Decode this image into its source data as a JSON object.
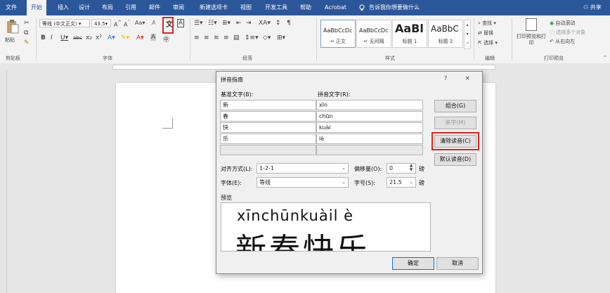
{
  "tabs": [
    "文件",
    "开始",
    "插入",
    "设计",
    "布局",
    "引用",
    "邮件",
    "审阅",
    "新建选项卡",
    "视图",
    "开发工具",
    "帮助",
    "Acrobat"
  ],
  "active_tab": "开始",
  "tell_me": "告诉我你想要做什么",
  "share": "共享",
  "ribbon": {
    "paste": "粘贴",
    "font_name": "等线 (中文正文)",
    "font_size": "43.5",
    "styles": [
      {
        "sample": "AaBbCcDc",
        "name": "正文"
      },
      {
        "sample": "AaBbCcDc",
        "name": "无间隔"
      },
      {
        "sample": "AaBl",
        "name": "标题 1"
      },
      {
        "sample": "AaBbC",
        "name": "标题 2"
      }
    ],
    "find": "查找",
    "replace": "替换",
    "select": "选择",
    "print_preview": "打印预览和打印",
    "auto_scroll": "自动滚动",
    "select_multi": "选择多个对象",
    "rtl": "从右向左",
    "groups": [
      "剪贴板",
      "字体",
      "段落",
      "样式",
      "编辑",
      "打印预览"
    ]
  },
  "dialog": {
    "title": "拼音指南",
    "help": "?",
    "close": "✕",
    "base_label": "基准文字(B):",
    "ruby_label": "拼音文字(R):",
    "rows": [
      {
        "base": "新",
        "ruby": "xīn"
      },
      {
        "base": "春",
        "ruby": "chūn"
      },
      {
        "base": "快",
        "ruby": "kuài"
      },
      {
        "base": "乐",
        "ruby": "lè"
      },
      {
        "base": "",
        "ruby": ""
      }
    ],
    "btn_group": "组合(G)",
    "btn_mono": "单字(M)",
    "btn_clear": "清除读音(C)",
    "btn_default": "默认读音(D)",
    "align_label": "对齐方式(L):",
    "align_value": "1-2-1",
    "offset_label": "偏移量(O):",
    "offset_value": "0",
    "offset_unit": "磅",
    "font_label": "字体(E):",
    "font_value": "等线",
    "size_label": "字号(S):",
    "size_value": "21.5",
    "size_unit": "磅",
    "preview_label": "预览",
    "preview_ruby": "xīnchūnkuàil è",
    "preview_base": "新春快乐",
    "ok": "确定",
    "cancel": "取消"
  },
  "colors": {
    "brand": "#2b579a",
    "highlight": "#d22222"
  }
}
